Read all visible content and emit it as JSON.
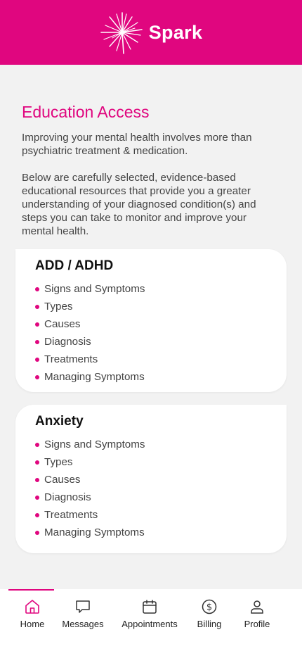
{
  "header": {
    "brand_name": "Spark",
    "logo_icon": "starburst-logo",
    "brand_color": "#e0067f"
  },
  "page": {
    "title": "Education Access",
    "paragraph_1": "Improving your mental health involves more than psychiatric treatment & medication.",
    "paragraph_2": "Below are carefully selected, evidence-based educational resources that provide you a greater understanding of your diagnosed condition(s) and steps you can take to monitor and improve your mental health."
  },
  "cards": [
    {
      "title": "ADD / ADHD",
      "items": [
        "Signs and Symptoms",
        "Types",
        "Causes",
        "Diagnosis",
        "Treatments",
        "Managing Symptoms"
      ]
    },
    {
      "title": "Anxiety",
      "items": [
        "Signs and Symptoms",
        "Types",
        "Causes",
        "Diagnosis",
        "Treatments",
        "Managing Symptoms"
      ]
    }
  ],
  "tabbar": {
    "active": "Home",
    "tabs": [
      {
        "label": "Home",
        "icon": "home-icon"
      },
      {
        "label": "Messages",
        "icon": "chat-bubble-icon"
      },
      {
        "label": "Appointments",
        "icon": "calendar-icon"
      },
      {
        "label": "Billing",
        "icon": "dollar-circle-icon"
      },
      {
        "label": "Profile",
        "icon": "person-icon"
      }
    ]
  }
}
